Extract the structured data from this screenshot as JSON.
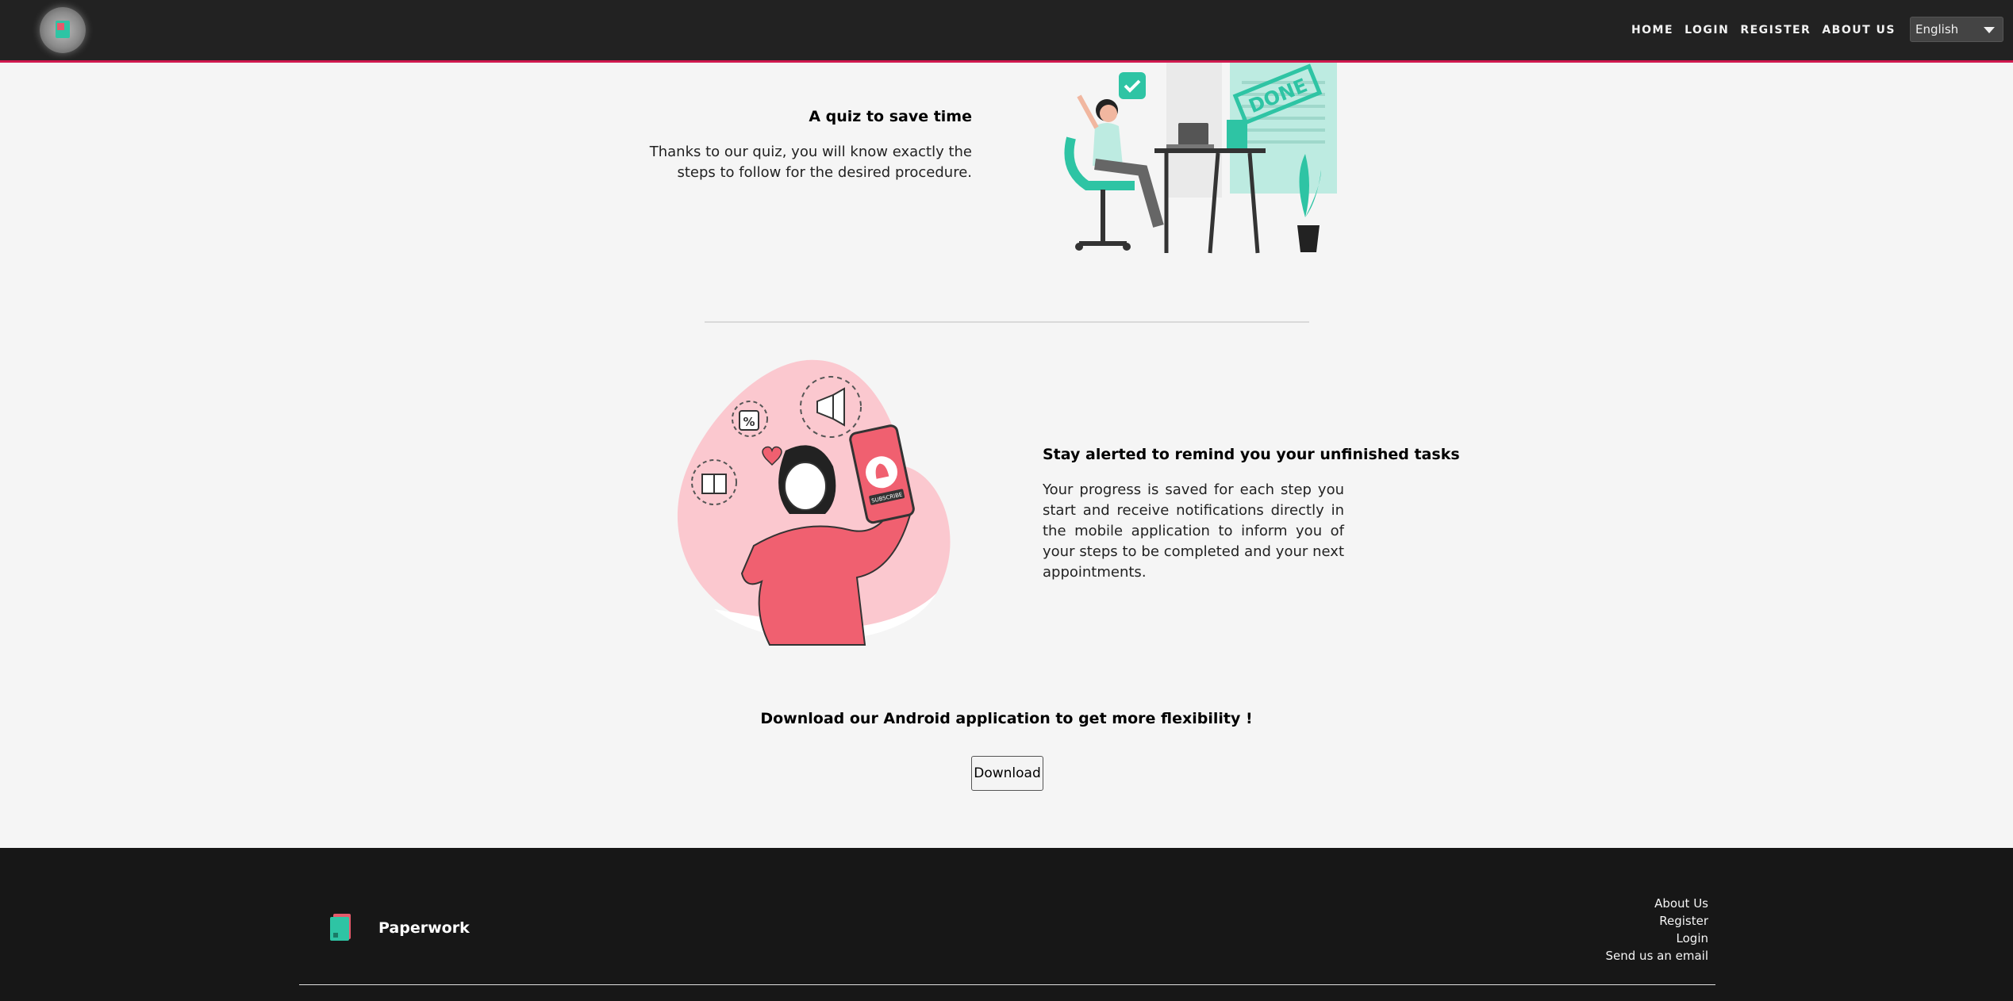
{
  "header": {
    "nav": [
      "HOME",
      "LOGIN",
      "REGISTER",
      "ABOUT US"
    ],
    "language": "English"
  },
  "sections": [
    {
      "title": "A quiz to save time",
      "text": "Thanks to our quiz, you will know exactly the steps to follow for the desired procedure."
    },
    {
      "title": "Stay alerted to remind you your unfinished tasks",
      "text": "Your progress is saved for each step you start and receive notifications directly in the mobile application to inform you of your steps to be completed and your next appointments."
    }
  ],
  "illustrations": {
    "done_stamp": "DONE",
    "subscribe_badge": "SUBSCRIBE",
    "percent_tag": "%"
  },
  "cta": {
    "text": "Download our Android application to get more flexibility !",
    "button": "Download"
  },
  "footer": {
    "brand": "Paperwork",
    "links": [
      "About Us",
      "Register",
      "Login",
      "Send us an email"
    ]
  },
  "colors": {
    "accent": "#d0194f",
    "teal": "#2ec4a4",
    "pink": "#f06070"
  }
}
